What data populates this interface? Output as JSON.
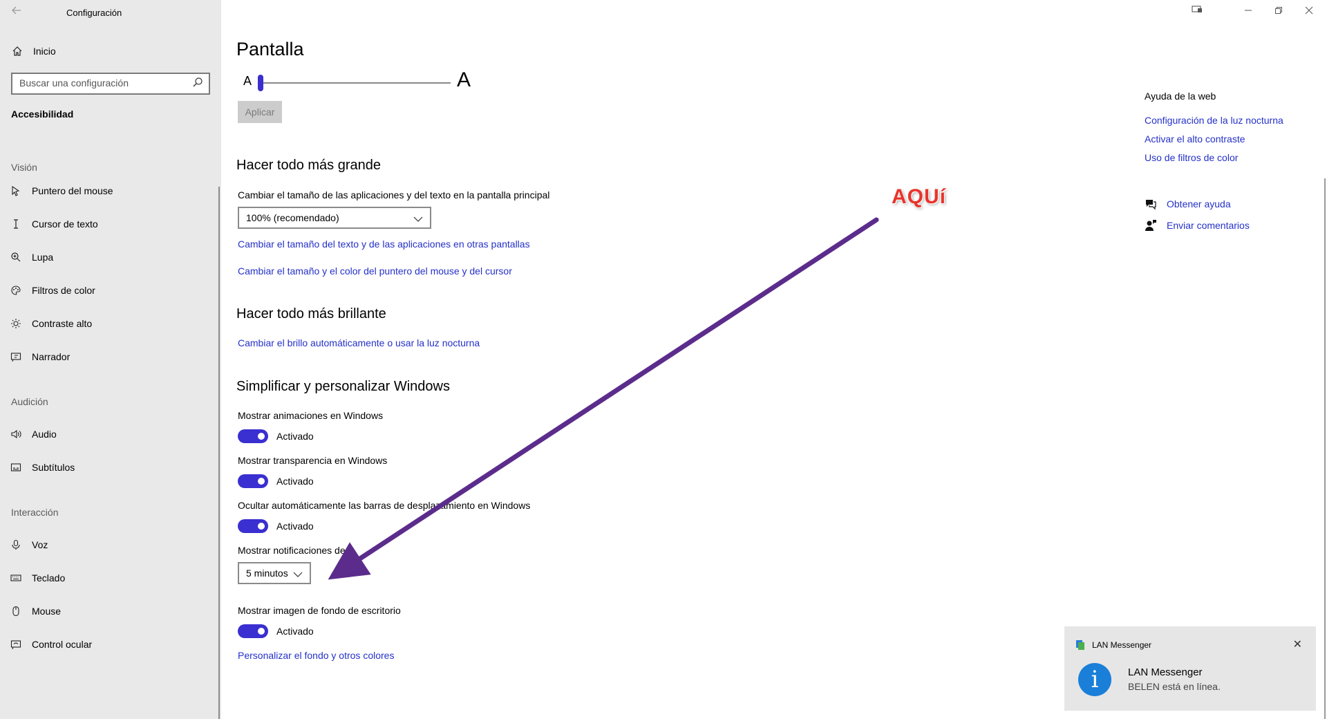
{
  "window": {
    "title": "Configuración",
    "back_icon": "back-arrow-icon",
    "controls": [
      "display-icon",
      "minimize-icon",
      "restore-icon",
      "close-icon"
    ]
  },
  "sidebar": {
    "home_label": "Inicio",
    "search_placeholder": "Buscar una configuración",
    "section_title": "Accesibilidad",
    "groups": {
      "vision": "Visión",
      "audicion": "Audición",
      "interaccion": "Interacción"
    },
    "items": [
      {
        "label": "Puntero del mouse",
        "icon": "mouse-pointer-icon"
      },
      {
        "label": "Cursor de texto",
        "icon": "text-cursor-icon"
      },
      {
        "label": "Lupa",
        "icon": "magnifier-icon"
      },
      {
        "label": "Filtros de color",
        "icon": "palette-icon"
      },
      {
        "label": "Contraste alto",
        "icon": "sun-contrast-icon"
      },
      {
        "label": "Narrador",
        "icon": "narrator-icon"
      },
      {
        "label": "Audio",
        "icon": "speaker-icon"
      },
      {
        "label": "Subtítulos",
        "icon": "captions-icon"
      },
      {
        "label": "Voz",
        "icon": "microphone-icon"
      },
      {
        "label": "Teclado",
        "icon": "keyboard-icon"
      },
      {
        "label": "Mouse",
        "icon": "mouse-icon"
      },
      {
        "label": "Control ocular",
        "icon": "eye-control-icon"
      }
    ]
  },
  "main": {
    "page_title": "Pantalla",
    "slider": {
      "small_label": "A",
      "big_label": "A",
      "value": 0
    },
    "apply_label": "Aplicar",
    "section_bigger": {
      "title": "Hacer todo más grande",
      "scale_label": "Cambiar el tamaño de las aplicaciones y del texto en la pantalla principal",
      "scale_value": "100% (recomendado)",
      "link_other_displays": "Cambiar el tamaño del texto y de las aplicaciones en otras pantallas",
      "link_pointer": "Cambiar el tamaño y el color del puntero del mouse y del cursor"
    },
    "section_brighter": {
      "title": "Hacer todo más brillante",
      "link_brightness": "Cambiar el brillo automáticamente o usar la luz nocturna"
    },
    "section_simplify": {
      "title": "Simplificar y personalizar Windows",
      "animations_label": "Mostrar animaciones en Windows",
      "animations_state": "Activado",
      "transparency_label": "Mostrar transparencia en Windows",
      "transparency_state": "Activado",
      "scrollbars_label": "Ocultar automáticamente las barras de desplazamiento en Windows",
      "scrollbars_state": "Activado",
      "notifications_label": "Mostrar notificaciones de",
      "notifications_value": "5 minutos",
      "wallpaper_label": "Mostrar imagen de fondo de escritorio",
      "wallpaper_state": "Activado",
      "link_personalize": "Personalizar el fondo y otros colores"
    }
  },
  "right_panel": {
    "title": "Ayuda de la web",
    "links": [
      "Configuración de la luz nocturna",
      "Activar el alto contraste",
      "Uso de filtros de color"
    ],
    "get_help": "Obtener ayuda",
    "feedback": "Enviar comentarios"
  },
  "annotation": {
    "text": "AQUí",
    "color": "#e8342c",
    "arrow_color": "#5b2c8c"
  },
  "toast": {
    "app_name": "LAN Messenger",
    "title": "LAN Messenger",
    "body": "BELEN está en línea.",
    "icon_glyph": "i",
    "icon": "info-icon"
  },
  "colors": {
    "accent": "#3a2fd0",
    "link": "#2430c8",
    "sidebar_bg": "#e9e9e9"
  }
}
